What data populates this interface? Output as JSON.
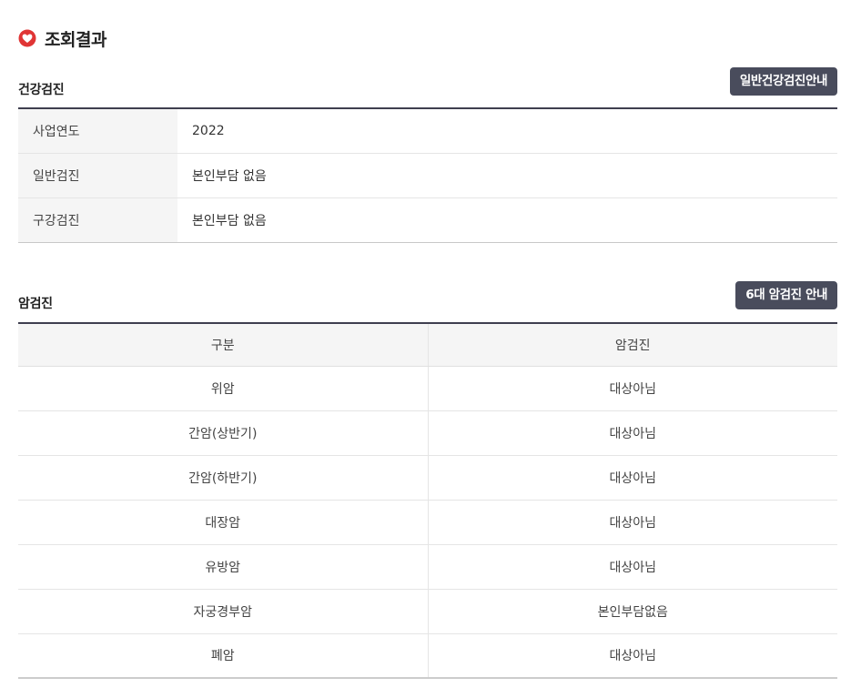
{
  "header": {
    "title": "조회결과",
    "icon": "heart-badge-icon",
    "icon_color": "#e03535"
  },
  "health_checkup": {
    "title": "건강검진",
    "guide_button": "일반건강검진안내",
    "rows": [
      {
        "label": "사업연도",
        "value": "2022"
      },
      {
        "label": "일반검진",
        "value": "본인부담 없음"
      },
      {
        "label": "구강검진",
        "value": "본인부담 없음"
      }
    ]
  },
  "cancer_checkup": {
    "title": "암검진",
    "guide_button": "6대 암검진 안내",
    "columns": [
      "구분",
      "암검진"
    ],
    "rows": [
      {
        "type": "위암",
        "status": "대상아님"
      },
      {
        "type": "간암(상반기)",
        "status": "대상아님"
      },
      {
        "type": "간암(하반기)",
        "status": "대상아님"
      },
      {
        "type": "대장암",
        "status": "대상아님"
      },
      {
        "type": "유방암",
        "status": "대상아님"
      },
      {
        "type": "자궁경부암",
        "status": "본인부담없음"
      },
      {
        "type": "폐암",
        "status": "대상아님"
      }
    ]
  },
  "colors": {
    "button_bg": "#494c5c",
    "table_border": "#3f3f4f",
    "header_bg": "#f5f5f5"
  }
}
